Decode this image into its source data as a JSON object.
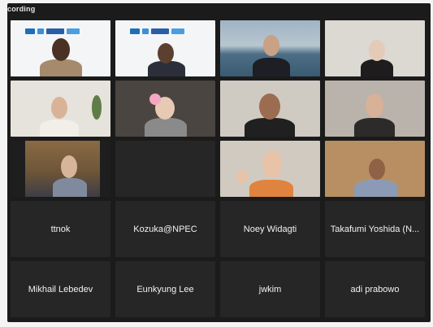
{
  "header": {
    "recording_label": "cording"
  },
  "participants": [
    {
      "name": "",
      "video": true,
      "speaking": true
    },
    {
      "name": "",
      "video": true
    },
    {
      "name": "",
      "video": true
    },
    {
      "name": "",
      "video": true
    },
    {
      "name": "",
      "video": true
    },
    {
      "name": "",
      "video": true
    },
    {
      "name": "",
      "video": true
    },
    {
      "name": "",
      "video": true
    },
    {
      "name": "",
      "video": true
    },
    {
      "name": "",
      "video": false
    },
    {
      "name": "",
      "video": true
    },
    {
      "name": "",
      "video": true
    },
    {
      "name": "ttnok",
      "video": false
    },
    {
      "name": "Kozuka@NPEC",
      "video": false
    },
    {
      "name": "Noey Widagti",
      "video": false
    },
    {
      "name": "Takafumi Yoshida (N...",
      "video": false
    },
    {
      "name": "Mikhail Lebedev",
      "video": false
    },
    {
      "name": "Eunkyung Lee",
      "video": false
    },
    {
      "name": "jwkim",
      "video": false
    },
    {
      "name": "adi prabowo",
      "video": false
    }
  ]
}
